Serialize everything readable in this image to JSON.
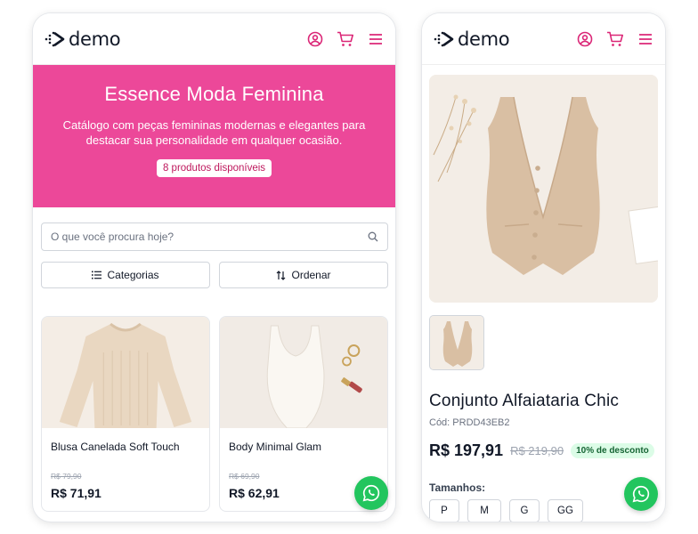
{
  "brand": {
    "logo_text": "demo",
    "accent": "#ec4899"
  },
  "header": {
    "icons": [
      "user-circle-icon",
      "cart-icon",
      "menu-icon"
    ]
  },
  "catalog": {
    "hero": {
      "title": "Essence Moda Feminina",
      "subtitle": "Catálogo com peças femininas modernas e elegantes para destacar sua personalidade em qualquer ocasião.",
      "badge": "8 produtos disponíveis"
    },
    "search": {
      "placeholder": "O que você procura hoje?"
    },
    "filters": {
      "categories_label": "Categorias",
      "sort_label": "Ordenar"
    },
    "products": [
      {
        "name": "Blusa Canelada Soft Touch",
        "old_price": "R$ 79,90",
        "price": "R$ 71,91"
      },
      {
        "name": "Body Minimal Glam",
        "old_price": "R$ 69,90",
        "price": "R$ 62,91"
      }
    ]
  },
  "product_detail": {
    "title": "Conjunto Alfaiataria Chic",
    "code": "Cód: PRDD43EB2",
    "price": "R$ 197,91",
    "old_price": "R$ 219,90",
    "discount": "10% de desconto",
    "sizes_label": "Tamanhos:",
    "sizes": [
      "P",
      "M",
      "G",
      "GG"
    ]
  },
  "floating": {
    "whatsapp_icon": "whatsapp-icon",
    "color": "#22c55e"
  }
}
